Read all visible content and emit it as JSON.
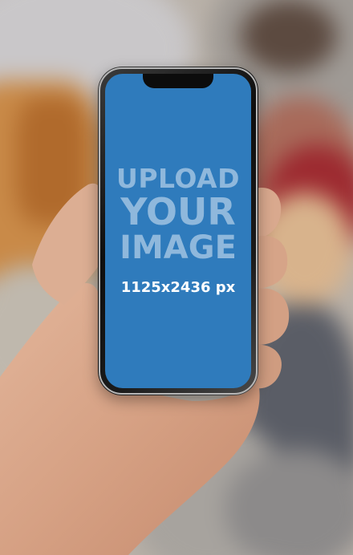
{
  "mockup": {
    "line1": "UPLOAD",
    "line2": "YOUR",
    "line3": "IMAGE",
    "dimensions": "1125x2436 px"
  },
  "colors": {
    "screen_blue": "#2f7bbc",
    "text_light_blue": "#8fb8dc",
    "skin": "#d9a98e",
    "background_warm": "#b9b1a8"
  }
}
